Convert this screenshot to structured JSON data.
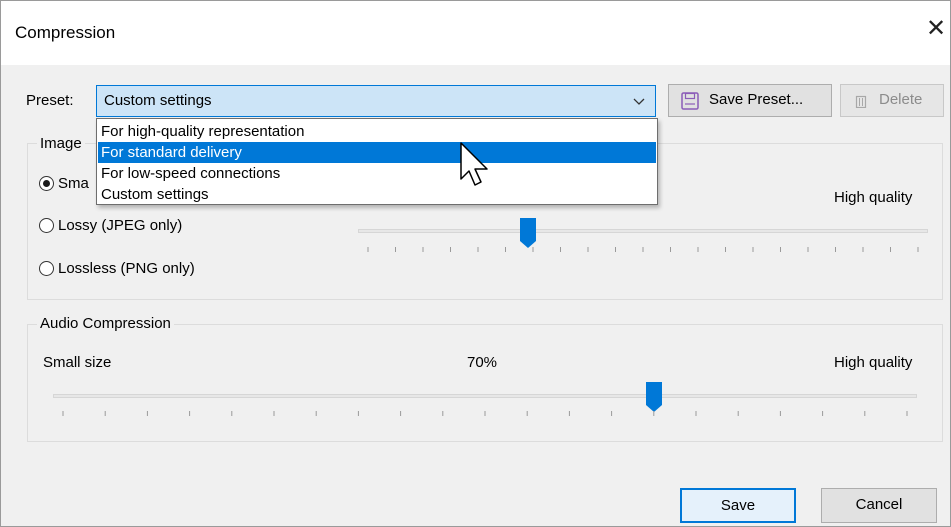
{
  "window": {
    "title": "Compression"
  },
  "preset": {
    "label": "Preset:",
    "selected": "Custom settings",
    "options": [
      "For high-quality representation",
      "For standard delivery",
      "For low-speed connections",
      "Custom settings"
    ],
    "highlighted_index": 1
  },
  "buttons": {
    "save_preset": "Save Preset...",
    "delete": "Delete",
    "save": "Save",
    "cancel": "Cancel"
  },
  "image_compression": {
    "title": "Image",
    "options": [
      "Sma",
      "Lossy (JPEG only)",
      "Lossless (PNG only)"
    ],
    "selected_index": 0,
    "right_label": "High quality",
    "slider_fraction": 0.29
  },
  "audio_compression": {
    "title": "Audio Compression",
    "left_label": "Small size",
    "value_label": "70%",
    "right_label": "High quality",
    "value": 0.7
  },
  "colors": {
    "accent": "#0078d7",
    "selection": "#cce4f7"
  }
}
